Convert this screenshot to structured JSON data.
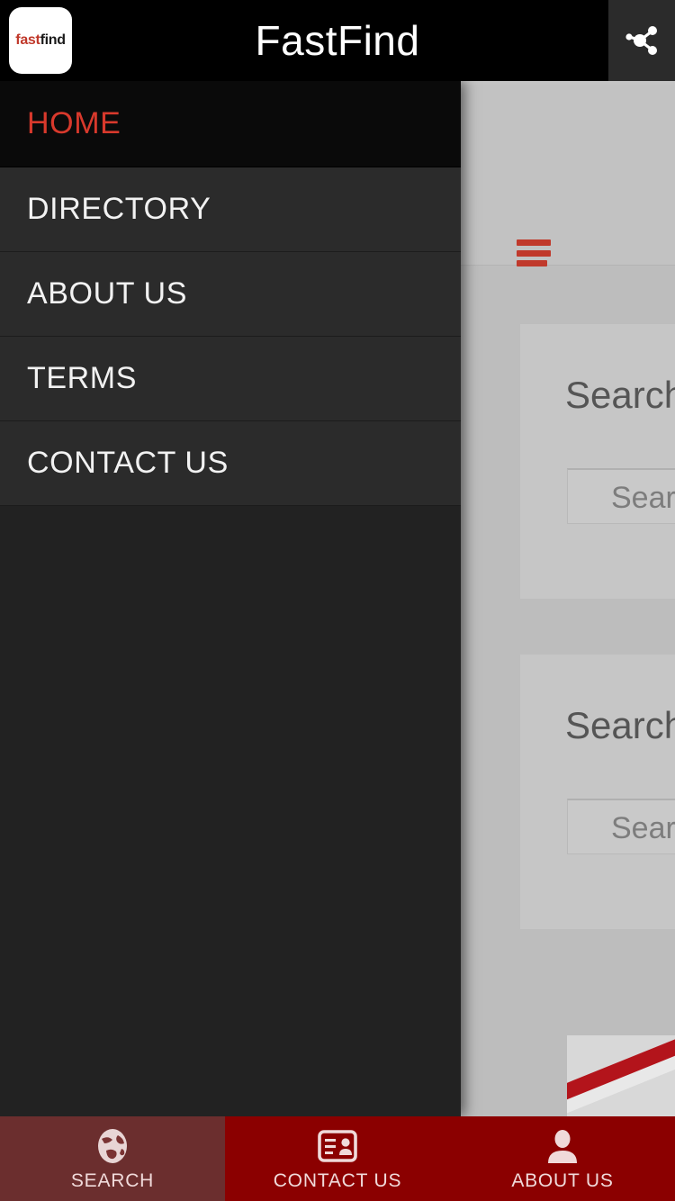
{
  "header": {
    "title": "FastFind",
    "logo_first": "fast",
    "logo_second": "find",
    "share_icon": "share-nodes-icon",
    "logo_icon": "app-logo-icon"
  },
  "drawer": {
    "items": [
      {
        "label": "HOME",
        "active": true
      },
      {
        "label": "DIRECTORY",
        "active": false
      },
      {
        "label": "ABOUT US",
        "active": false
      },
      {
        "label": "TERMS",
        "active": false
      },
      {
        "label": "CONTACT US",
        "active": false
      }
    ]
  },
  "background": {
    "menu_toggle_icon": "hamburger-menu-icon",
    "cards": [
      {
        "title": "Search",
        "input_placeholder": "Search..."
      },
      {
        "title": "Search",
        "input_placeholder": "Search..."
      }
    ]
  },
  "bottom_nav": {
    "items": [
      {
        "label": "SEARCH",
        "icon": "globe-icon",
        "active": true
      },
      {
        "label": "CONTACT US",
        "icon": "contact-card-icon",
        "active": false
      },
      {
        "label": "ABOUT US",
        "icon": "person-icon",
        "active": false
      }
    ]
  },
  "colors": {
    "accent_red": "#c0392b",
    "active_red": "#d8392c",
    "nav_red": "#8b0000",
    "nav_active_red": "#6b2e2e",
    "drawer_bg": "#2b2b2b",
    "drawer_active_bg": "#0a0a0a",
    "page_bg": "#bdbdbd",
    "header_bg": "#000000"
  }
}
